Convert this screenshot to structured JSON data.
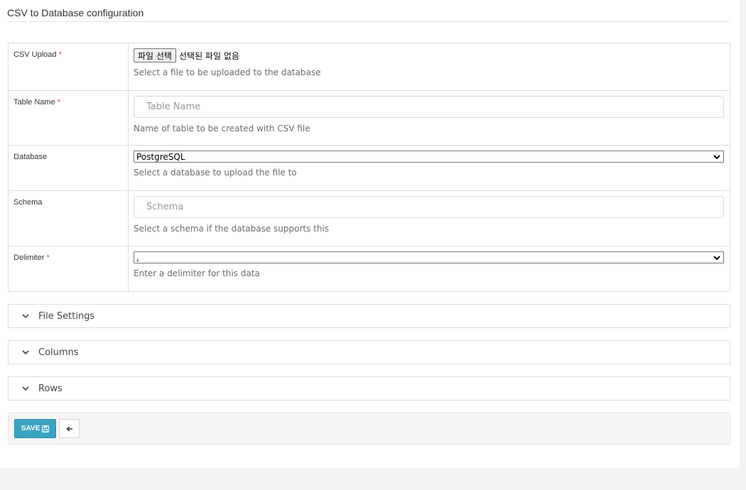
{
  "page": {
    "title": "CSV to Database configuration"
  },
  "form": {
    "csv_upload": {
      "label": "CSV Upload",
      "required_mark": "*",
      "button_label": "파일 선택",
      "status": "선택된 파일 없음",
      "help": "Select a file to be uploaded to the database"
    },
    "table_name": {
      "label": "Table Name",
      "required_mark": "*",
      "placeholder": "Table Name",
      "value": "",
      "help": "Name of table to be created with CSV file"
    },
    "database": {
      "label": "Database",
      "selected": "PostgreSQL",
      "help": "Select a database to upload the file to"
    },
    "schema": {
      "label": "Schema",
      "placeholder": "Schema",
      "value": "",
      "help": "Select a schema if the database supports this"
    },
    "delimiter": {
      "label": "Delimiter",
      "required_mark": "*",
      "selected": ",",
      "help": "Enter a delimiter for this data"
    }
  },
  "sections": [
    {
      "label": "File Settings",
      "expanded": false
    },
    {
      "label": "Columns",
      "expanded": false
    },
    {
      "label": "Rows",
      "expanded": false
    }
  ],
  "footer": {
    "save_label": "SAVE",
    "save_icon": "floppy-disk-icon",
    "back_icon": "arrow-left-icon"
  },
  "colors": {
    "save_button": "#3aa3c2",
    "required": "#e04848",
    "border": "#dcdcdc"
  }
}
